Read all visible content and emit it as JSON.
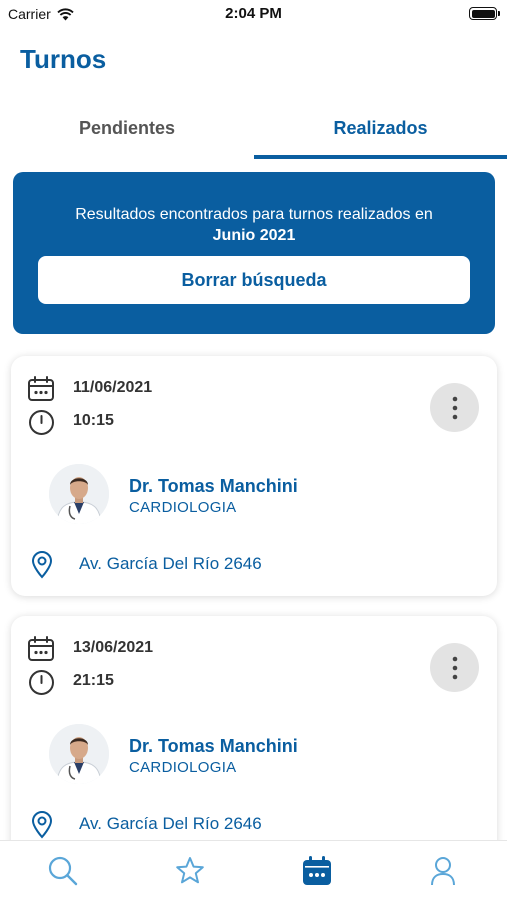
{
  "status_bar": {
    "carrier": "Carrier",
    "time": "2:04 PM"
  },
  "header": {
    "title": "Turnos"
  },
  "tabs": [
    {
      "label": "Pendientes",
      "active": false
    },
    {
      "label": "Realizados",
      "active": true
    }
  ],
  "filter_banner": {
    "message": "Resultados encontrados para turnos realizados en",
    "period": "Junio 2021",
    "clear_label": "Borrar búsqueda"
  },
  "appointments": [
    {
      "date": "11/06/2021",
      "time": "10:15",
      "doctor": "Dr. Tomas Manchini",
      "specialty": "CARDIOLOGIA",
      "address": "Av. García Del Río 2646"
    },
    {
      "date": "13/06/2021",
      "time": "21:15",
      "doctor": "Dr. Tomas Manchini",
      "specialty": "CARDIOLOGIA",
      "address": "Av. García Del Río 2646"
    }
  ],
  "bottom_nav": [
    {
      "icon": "search-icon",
      "active": false
    },
    {
      "icon": "star-icon",
      "active": false
    },
    {
      "icon": "calendar-icon",
      "active": true
    },
    {
      "icon": "profile-icon",
      "active": false
    }
  ],
  "colors": {
    "primary": "#0a5ea0",
    "nav_inactive": "#5aa6d8",
    "card_text": "#333333"
  }
}
